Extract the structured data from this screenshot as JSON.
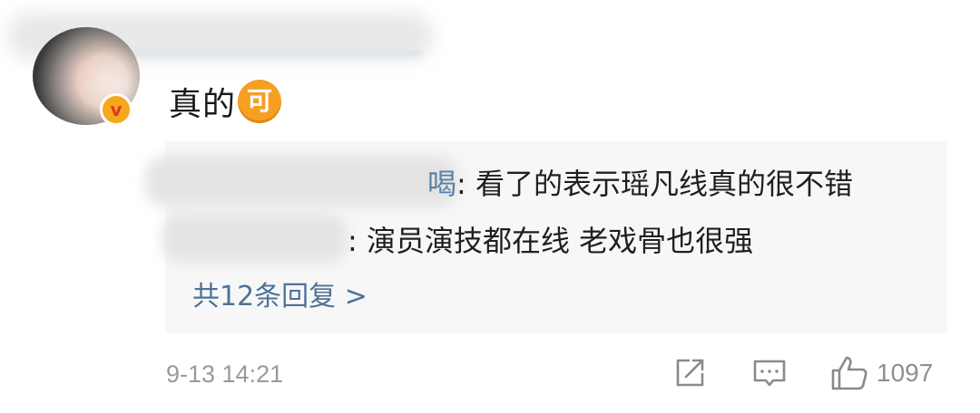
{
  "post": {
    "comment_text": "真的",
    "emoji_label": "可",
    "verified_badge_glyph": "v"
  },
  "replies": [
    {
      "name_visible_tail": "喝",
      "text": ": 看了的表示瑶凡线真的很不错"
    },
    {
      "name_visible_tail": "",
      "text": ": 演员演技都在线 老戏骨也很强"
    }
  ],
  "more_replies_label": "共12条回复 >",
  "footer": {
    "timestamp": "9-13 14:21",
    "like_count": "1097"
  },
  "icons": {
    "share": "share-icon",
    "comment": "comment-icon",
    "like": "thumbs-up-icon"
  },
  "colors": {
    "link": "#4e7298",
    "badge": "#f4a81b",
    "emoji": "#f5a023",
    "reply_bg": "#f7f7f7"
  }
}
